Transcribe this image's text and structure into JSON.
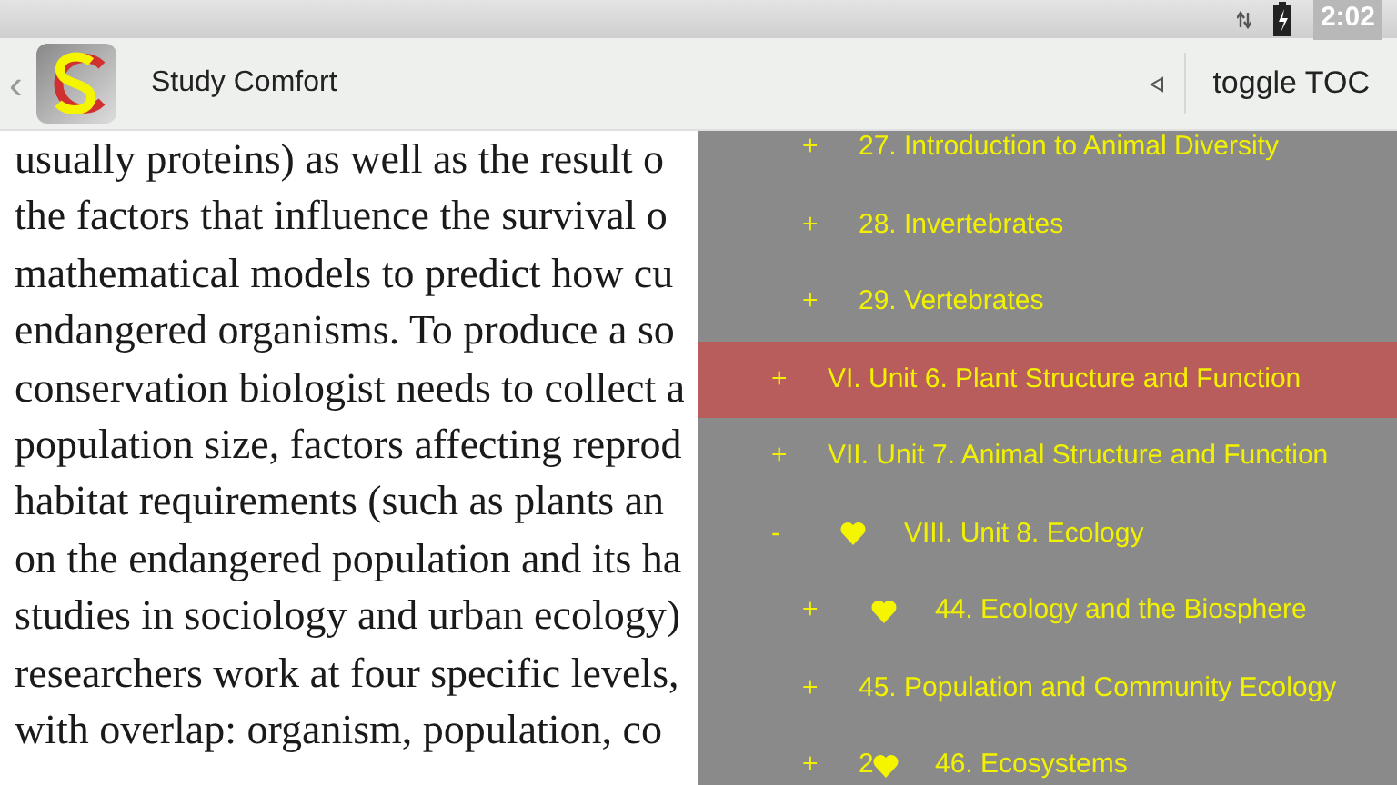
{
  "status_bar": {
    "time": "2:02"
  },
  "action_bar": {
    "back": "‹",
    "title": "Study Comfort",
    "toggle_button": "toggle TOC"
  },
  "article": {
    "lines": [
      "usually proteins) as well as the result o",
      "the factors that influence the survival o",
      "mathematical models to predict how cu",
      "endangered organisms. To produce a so",
      "conservation biologist needs to collect a",
      "population size, factors affecting reprod",
      "habitat requirements (such as plants an",
      "on the endangered population and its ha",
      "studies in sociology and urban ecology)",
      "researchers work at four specific levels,",
      "with overlap: organism, population, co"
    ]
  },
  "toc": [
    {
      "children": [
        {
          "expander": "+",
          "favorite": false,
          "label": "27. Introduction to Animal Diversity",
          "selected": false
        },
        {
          "expander": "+",
          "favorite": false,
          "label": "28. Invertebrates",
          "selected": false
        },
        {
          "expander": "+",
          "favorite": false,
          "label": "29. Vertebrates",
          "selected": false
        }
      ]
    },
    {
      "expander": "+",
      "favorite": false,
      "label": "VI. Unit 6. Plant Structure and Function",
      "selected": true
    },
    {
      "expander": "+",
      "favorite": false,
      "label": "VII. Unit 7. Animal Structure and Function",
      "selected": false
    },
    {
      "expander": "-",
      "favorite": true,
      "label": "VIII. Unit 8. Ecology",
      "selected": false,
      "children": [
        {
          "expander": "+",
          "favorite": true,
          "label": "44. Ecology and the Biosphere",
          "selected": false
        },
        {
          "expander": "+",
          "favorite": false,
          "label": "45. Population and Community Ecology",
          "selected": false
        },
        {
          "expander": "+",
          "favorite": true,
          "favorite_count": "2",
          "label": "46. Ecosystems",
          "selected": false
        }
      ]
    }
  ]
}
